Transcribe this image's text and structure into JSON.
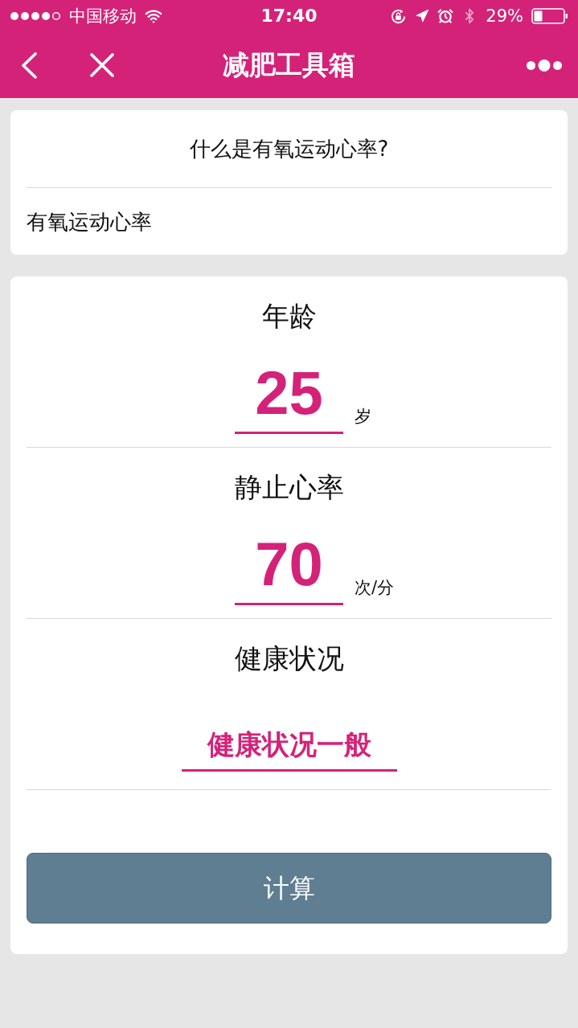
{
  "status_bar": {
    "carrier": "中国移动",
    "time": "17:40",
    "battery": "29%"
  },
  "nav": {
    "title": "减肥工具箱"
  },
  "info_card": {
    "question": "什么是有氧运动心率?",
    "link": "有氧运动心率"
  },
  "form": {
    "fields": [
      {
        "kind": "number",
        "label": "年龄",
        "value": "25",
        "unit": "岁"
      },
      {
        "kind": "number",
        "label": "静止心率",
        "value": "70",
        "unit": "次/分"
      },
      {
        "kind": "select",
        "label": "健康状况",
        "value": "健康状况一般"
      }
    ],
    "button": "计算"
  }
}
